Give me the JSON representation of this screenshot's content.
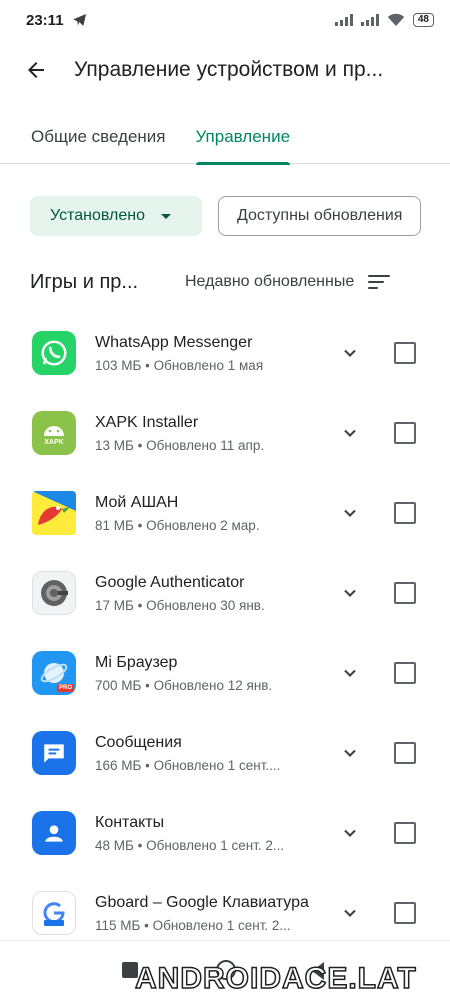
{
  "status_bar": {
    "time": "23:11",
    "battery": "48"
  },
  "app_bar": {
    "title": "Управление устройством и пр..."
  },
  "tabs": [
    {
      "label": "Общие сведения",
      "selected": false
    },
    {
      "label": "Управление",
      "selected": true
    }
  ],
  "filters": {
    "installed_label": "Установлено",
    "updates_label": "Доступны обновления"
  },
  "list_header": {
    "title": "Игры и пр...",
    "sort_label": "Недавно обновленные"
  },
  "apps": [
    {
      "name": "WhatsApp Messenger",
      "meta": "103 МБ  •  Обновлено 1 мая",
      "icon": "whatsapp-icon"
    },
    {
      "name": "XAPK Installer",
      "meta": "13 МБ  •  Обновлено 11 апр.",
      "icon": "xapk-installer-icon",
      "icon_text": "XAPK"
    },
    {
      "name": "Мой АШАН",
      "meta": "81 МБ  •  Обновлено 2 мар.",
      "icon": "auchan-icon"
    },
    {
      "name": "Google Authenticator",
      "meta": "17 МБ  •  Обновлено 30 янв.",
      "icon": "authenticator-icon"
    },
    {
      "name": "Mi Браузер",
      "meta": "700 МБ  •  Обновлено 12 янв.",
      "icon": "mi-browser-icon",
      "icon_text": "PRO"
    },
    {
      "name": "Сообщения",
      "meta": "166 МБ  •  Обновлено 1 сент....",
      "icon": "messages-icon"
    },
    {
      "name": "Контакты",
      "meta": "48 МБ  •  Обновлено 1 сент. 2...",
      "icon": "contacts-icon"
    },
    {
      "name": "Gboard – Google Клавиатура",
      "meta": "115 МБ  •  Обновлено 1 сент. 2...",
      "icon": "gboard-icon"
    }
  ],
  "watermark": "ANDROIDACE.LAT",
  "colors": {
    "accent": "#01875f",
    "chip_bg": "#e6f4ee",
    "text": "#202124",
    "secondary_text": "#5f6368"
  }
}
